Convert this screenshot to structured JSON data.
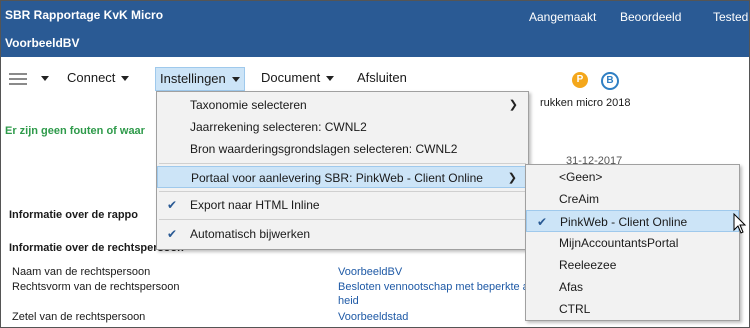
{
  "header": {
    "app_title": "SBR Rapportage KvK Micro",
    "company": "VoorbeeldBV",
    "status_items": [
      "Aangemaakt",
      "Beoordeeld",
      "Tested"
    ]
  },
  "menubar": {
    "items": [
      "Connect",
      "Instellingen",
      "Document",
      "Afsluiten"
    ],
    "icons": [
      "hamburger-icon",
      "p-icon",
      "b-icon"
    ],
    "p_label": "P",
    "b_label": "B"
  },
  "content": {
    "doc_title_fragment": "rukken micro 2018",
    "errors_text": "Er zijn geen fouten of waar",
    "date": "31-12-2017",
    "section1": "Informatie over de rappo",
    "section2": "Informatie over de rechtspersoon",
    "rows": [
      {
        "label": "Naam van de rechtspersoon",
        "value": "VoorbeeldBV"
      },
      {
        "label": "Rechtsvorm van de rechtspersoon",
        "value": "Besloten vennootschap met beperkte a",
        "value2": "heid"
      },
      {
        "label": "Zetel van de rechtspersoon",
        "value": "Voorbeeldstad"
      }
    ]
  },
  "dropdown": {
    "items": [
      {
        "label": "Taxonomie selecteren",
        "submenu": true,
        "checked": false
      },
      {
        "label": "Jaarrekening selecteren: CWNL2",
        "submenu": false,
        "checked": false
      },
      {
        "label": "Bron waarderingsgrondslagen selecteren: CWNL2",
        "submenu": false,
        "checked": false
      },
      {
        "label": "Portaal voor aanlevering SBR: PinkWeb - Client Online",
        "submenu": true,
        "checked": false,
        "highlighted": true
      },
      {
        "label": "Export naar HTML Inline",
        "submenu": false,
        "checked": true
      },
      {
        "label": "Automatisch bijwerken",
        "submenu": false,
        "checked": true
      }
    ]
  },
  "submenu": {
    "items": [
      {
        "label": "<Geen>",
        "checked": false
      },
      {
        "label": "CreAim",
        "checked": false
      },
      {
        "label": "PinkWeb - Client Online",
        "checked": true,
        "highlighted": true
      },
      {
        "label": "MijnAccountantsPortal",
        "checked": false
      },
      {
        "label": "Reeleezee",
        "checked": false
      },
      {
        "label": "Afas",
        "checked": false
      },
      {
        "label": "CTRL",
        "checked": false
      }
    ]
  },
  "colors": {
    "header_bg": "#2a5a94",
    "highlight": "#cce4f7",
    "error_ok": "#2e9a4a",
    "link": "#1f5aa6",
    "p_badge": "#f4a71b",
    "b_badge": "#2f7fc3"
  }
}
